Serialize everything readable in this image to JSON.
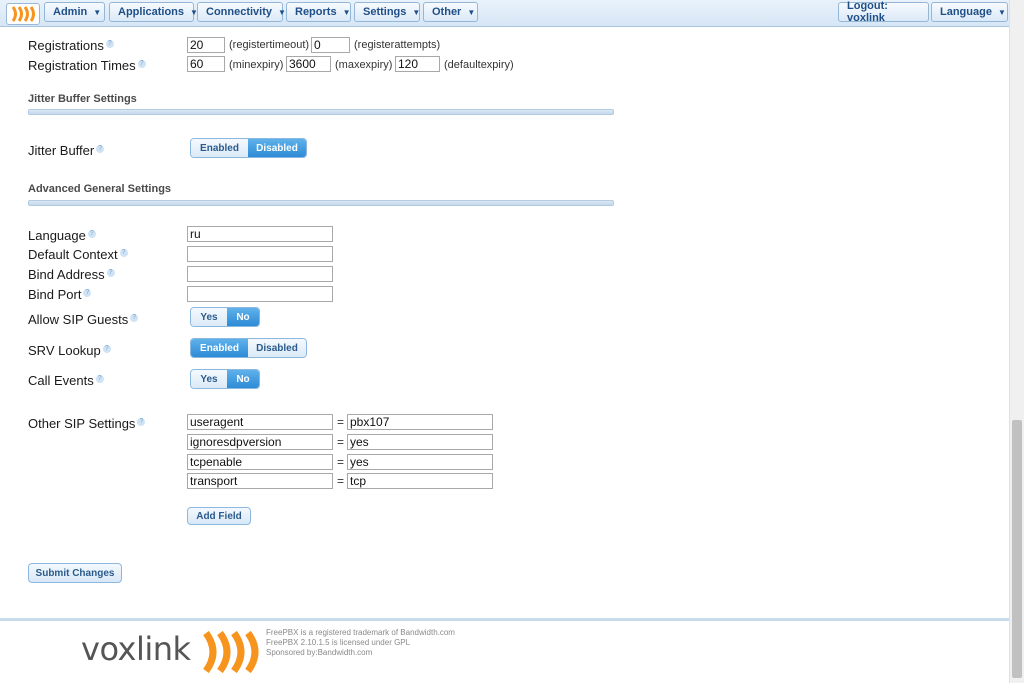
{
  "nav": {
    "menus": [
      "Admin",
      "Applications",
      "Connectivity",
      "Reports",
      "Settings",
      "Other"
    ],
    "logout": "Logout: voxlink",
    "language": "Language"
  },
  "registrations": {
    "label": "Registrations",
    "registertimeout": "20",
    "registertimeout_note": "(registertimeout)",
    "registerattempts": "0",
    "registerattempts_note": "(registerattempts)"
  },
  "registration_times": {
    "label": "Registration Times",
    "minexpiry": "60",
    "minexpiry_note": "(minexpiry)",
    "maxexpiry": "3600",
    "maxexpiry_note": "(maxexpiry)",
    "defaultexpiry": "120",
    "defaultexpiry_note": "(defaultexpiry)"
  },
  "jitter_section": {
    "title": "Jitter Buffer Settings",
    "jitter_label": "Jitter Buffer",
    "enabled": "Enabled",
    "disabled": "Disabled",
    "selected": "Disabled"
  },
  "advanced_section": {
    "title": "Advanced General Settings",
    "language_label": "Language",
    "language_value": "ru",
    "default_context_label": "Default Context",
    "default_context_value": "",
    "bind_address_label": "Bind Address",
    "bind_address_value": "",
    "bind_port_label": "Bind Port",
    "bind_port_value": "",
    "allow_guests_label": "Allow SIP Guests",
    "allow_guests_yes": "Yes",
    "allow_guests_no": "No",
    "allow_guests_selected": "No",
    "srv_label": "SRV Lookup",
    "srv_enabled": "Enabled",
    "srv_disabled": "Disabled",
    "srv_selected": "Enabled",
    "call_events_label": "Call Events",
    "call_events_yes": "Yes",
    "call_events_no": "No",
    "call_events_selected": "No"
  },
  "other_sip": {
    "label": "Other SIP Settings",
    "rows": [
      {
        "key": "useragent",
        "value": "pbx107"
      },
      {
        "key": "ignoresdpversion",
        "value": "yes"
      },
      {
        "key": "tcpenable",
        "value": "yes"
      },
      {
        "key": "transport",
        "value": "tcp"
      }
    ],
    "equals": "=",
    "add_field": "Add Field"
  },
  "submit": "Submit Changes",
  "footer": {
    "brand": "voxlink",
    "line1": "FreePBX is a registered trademark of Bandwidth.com",
    "line2": "FreePBX 2.10.1.5 is licensed under GPL",
    "line3": "Sponsored by:Bandwidth.com"
  },
  "colors": {
    "accent": "#2d8bd6",
    "brand_orange": "#f7941d"
  }
}
